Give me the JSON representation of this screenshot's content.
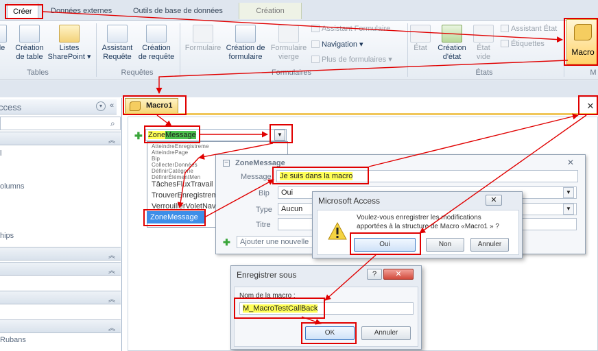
{
  "ribbon_tabs": {
    "create": "Créer",
    "external": "Données externes",
    "dbtools": "Outils de base de données",
    "creation": "Création"
  },
  "ribbon": {
    "tables": {
      "col1_partial": "le",
      "create_table": "Création\nde table",
      "sharepoint_lists": "Listes\nSharePoint ▾",
      "group": "Tables"
    },
    "queries": {
      "wizard": "Assistant\nRequête",
      "design": "Création\nde requête",
      "group": "Requêtes"
    },
    "forms": {
      "form": "Formulaire",
      "form_design": "Création de\nformulaire",
      "blank_form": "Formulaire\nvierge",
      "form_wizard": "Assistant Formulaire",
      "navigation": "Navigation ▾",
      "more_forms": "Plus de formulaires ▾",
      "group": "Formulaires"
    },
    "reports": {
      "report": "État",
      "report_design": "Création\nd'état",
      "blank_report": "État\nvide",
      "report_wizard": "Assistant État",
      "labels": "Étiquettes",
      "group": "États"
    },
    "macro": {
      "label": "Macro",
      "group_partial": "M"
    }
  },
  "nav_pane": {
    "title_partial": "ccess",
    "items_partial": [
      "l",
      "olumns",
      "hips",
      "Rubans"
    ]
  },
  "document_tab": {
    "title": "Macro1"
  },
  "macro_editor": {
    "action_combo": {
      "text_a": "Zone",
      "text_b": "Message"
    },
    "dropdown_small": [
      "AtteindreEnregistreme",
      "AtteindrePage",
      "Bip",
      "CollecterDonnées",
      "DéfinirCatégorie",
      "DéfinirÉlémentMen"
    ],
    "dropdown_items": [
      "TâchesFluxTravail",
      "TrouverEnregistrement",
      "VerrouillerVoletNav"
    ],
    "dropdown_selected": "ZoneMessage"
  },
  "zone_message_panel": {
    "header": "ZoneMessage",
    "message_label": "Message",
    "message_value": "Je suis dans la macro",
    "beep_label": "Bip",
    "beep_value": "Oui",
    "type_label": "Type",
    "type_value": "Aucun",
    "title_label": "Titre",
    "add_action_placeholder": "Ajouter une nouvelle"
  },
  "ms_access_dialog": {
    "title": "Microsoft Access",
    "message_line1": "Voulez-vous enregistrer les modifications",
    "message_line2": "apportées à la structure de Macro «Macro1 » ?",
    "yes": "Oui",
    "no": "Non",
    "cancel": "Annuler"
  },
  "save_as_dialog": {
    "title": "Enregistrer sous",
    "help": "?",
    "close": "✕",
    "field_label": "Nom de la macro :",
    "field_value": "M_MacroTestCallBack",
    "ok": "OK",
    "cancel": "Annuler"
  },
  "colors": {
    "highlight_red": "#e00000",
    "macro_yellow": "#f5cd60",
    "select_blue": "#3d8ee8",
    "text_highlight": "#ffff58"
  }
}
